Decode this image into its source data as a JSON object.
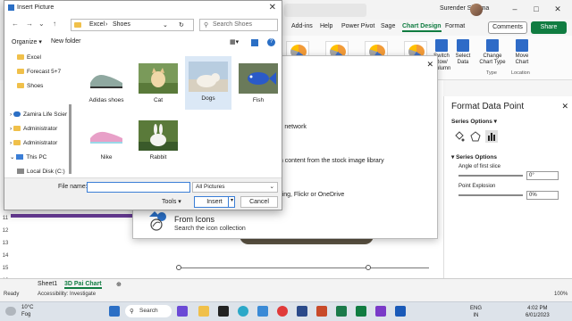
{
  "excel": {
    "user_name": "Surender Sharma",
    "ribbon_tabs": [
      "Add-ins",
      "Help",
      "Power Pivot",
      "Sage",
      "Chart Design",
      "Format"
    ],
    "active_tab": "Chart Design",
    "comments_label": "Comments",
    "share_label": "Share",
    "ribbon_buttons": {
      "switch_row": "Switch Row/ Column",
      "select_data": "Select Data",
      "change_chart_type": "Change Chart Type",
      "move_chart": "Move Chart"
    },
    "ribbon_groups": {
      "type": "Type",
      "location": "Location"
    },
    "row_numbers": [
      "11",
      "12",
      "13",
      "14",
      "15",
      "16"
    ]
  },
  "icons_dialog": {
    "line1": "al network",
    "line2": "m content from the stock image library",
    "line3": "Bing, Flickr or OneDrive",
    "from_icons_title": "From Icons",
    "from_icons_sub": "Search the icon collection"
  },
  "format_pane": {
    "title": "Format Data Point",
    "series_options_dropdown": "Series Options",
    "section": "Series Options",
    "angle_label": "Angle of first slice",
    "angle_value": "0°",
    "explosion_label": "Point Explosion",
    "explosion_value": "0%"
  },
  "sheets": {
    "tabs": [
      "Sheet1",
      "3D Pai Chart"
    ],
    "active": "3D Pai Chart"
  },
  "status": {
    "ready": "Ready",
    "accessibility": "Accessibility: Investigate",
    "zoom": "100%"
  },
  "insert_picture": {
    "title": "Insert Picture",
    "breadcrumb": [
      "Excel",
      "Shoes"
    ],
    "search_placeholder": "Search Shoes",
    "organize_label": "Organize",
    "new_folder_label": "New folder",
    "nav_items": [
      {
        "label": "Excel",
        "type": "folder"
      },
      {
        "label": "Forecast 5+7",
        "type": "folder"
      },
      {
        "label": "Shoes",
        "type": "folder"
      },
      {
        "label": "Zamira Life Scier",
        "type": "cloud"
      },
      {
        "label": "Administrator",
        "type": "folder"
      },
      {
        "label": "Administrator",
        "type": "folder"
      },
      {
        "label": "This PC",
        "type": "pc"
      },
      {
        "label": "Local Disk (C:)",
        "type": "disk"
      }
    ],
    "files": [
      {
        "name": "Adidas shoes",
        "selected": false
      },
      {
        "name": "Cat",
        "selected": false
      },
      {
        "name": "Dogs",
        "selected": true
      },
      {
        "name": "Fish",
        "selected": false
      },
      {
        "name": "Nike",
        "selected": false
      },
      {
        "name": "Rabbit",
        "selected": false
      }
    ],
    "file_name_label": "File name:",
    "file_name_value": "",
    "filter_value": "All Pictures",
    "tools_label": "Tools",
    "insert_label": "Insert",
    "cancel_label": "Cancel"
  },
  "taskbar": {
    "weather_temp": "10°C",
    "weather_desc": "Fog",
    "search_label": "Search",
    "lang": "ENG",
    "region": "IN",
    "time": "4:02 PM",
    "date": "6/01/2023"
  },
  "colors": {
    "excel_green": "#107c41",
    "selection_blue": "#dbe8f6",
    "folder_yellow": "#f0c04a"
  }
}
